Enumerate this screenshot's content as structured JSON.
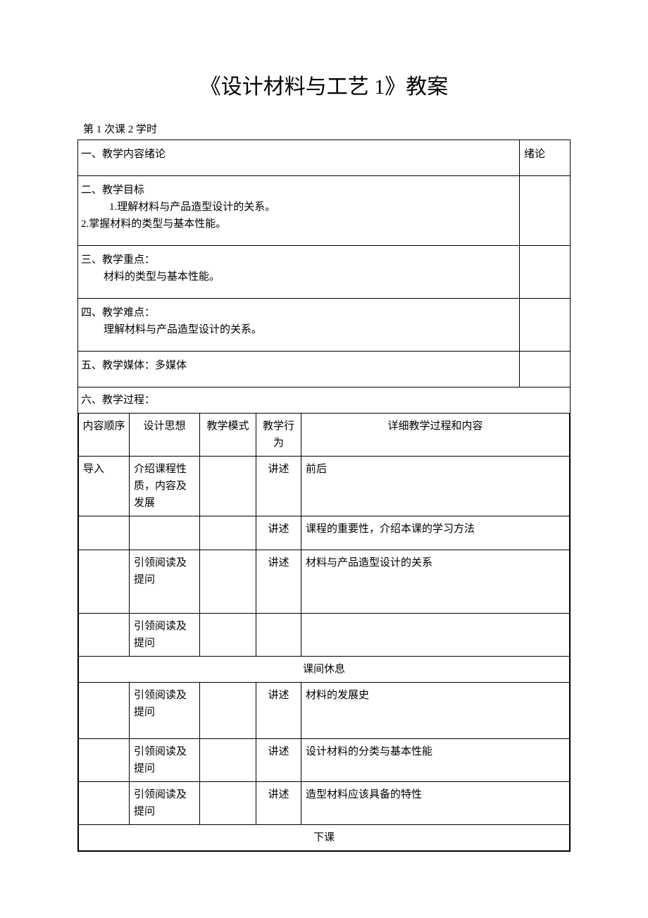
{
  "title": "《设计材料与工艺 1》教案",
  "session": "第 1 次课 2 学时",
  "sections": {
    "s1": {
      "heading": "一、教学内容绪论",
      "side": "绪论"
    },
    "s2": {
      "heading": "二、教学目标",
      "line1": "1.理解材料与产品造型设计的关系。",
      "line2": "2.掌握材料的类型与基本性能。"
    },
    "s3": {
      "heading": "三、教学重点：",
      "line1": "材料的类型与基本性能。"
    },
    "s4": {
      "heading": "四、教学难点：",
      "line1": "理解材料与产品造型设计的关系。"
    },
    "s5": {
      "heading": "五、教学媒体：多媒体"
    },
    "s6": {
      "heading": "六、教学过程："
    }
  },
  "proc_headers": {
    "c1": "内容顺序",
    "c2": "设计思想",
    "c3": "教学模式",
    "c4": "教学行为",
    "c5": "详细教学过程和内容"
  },
  "rows": {
    "r1": {
      "seq": "导入",
      "thought": "介绍课程性质，内容及发展",
      "mode": "",
      "action": "讲述",
      "detail": "前后"
    },
    "r2": {
      "seq": "",
      "thought": "",
      "mode": "",
      "action": "讲述",
      "detail": "课程的重要性，介绍本课的学习方法"
    },
    "r3": {
      "seq": "",
      "thought": "引领阅读及提问",
      "mode": "",
      "action": "讲述",
      "detail": "材料与产品造型设计的关系"
    },
    "r4": {
      "seq": "",
      "thought": "引领阅读及提问",
      "mode": "",
      "action": "",
      "detail": ""
    },
    "break1": "课间休息",
    "r5": {
      "seq": "",
      "thought": "引领阅读及提问",
      "mode": "",
      "action": "讲述",
      "detail": "材料的发展史"
    },
    "r6": {
      "seq": "",
      "thought": "引领阅读及提问",
      "mode": "",
      "action": "讲述",
      "detail": "设计材料的分类与基本性能"
    },
    "r7": {
      "seq": "",
      "thought": "引领阅读及提问",
      "mode": "",
      "action": "讲述",
      "detail": "造型材料应该具备的特性"
    },
    "break2": "下课"
  }
}
